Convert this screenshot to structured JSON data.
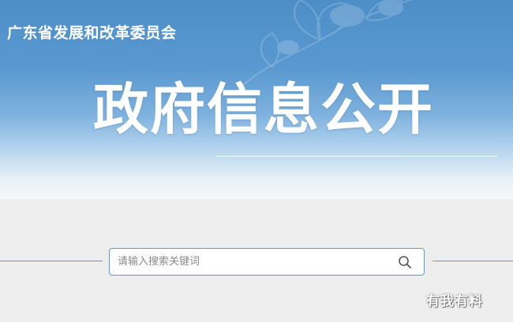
{
  "header": {
    "org_title": "广东省发展和改革委员会",
    "main_title": "政府信息公开"
  },
  "search": {
    "placeholder": "请输入搜索关键词",
    "value": "",
    "icon": "search-icon"
  },
  "watermark": {
    "text": "有我有料"
  },
  "colors": {
    "banner_top": "#4d8ec8",
    "accent": "#5a9bd5",
    "page_background": "#eeeeee"
  }
}
